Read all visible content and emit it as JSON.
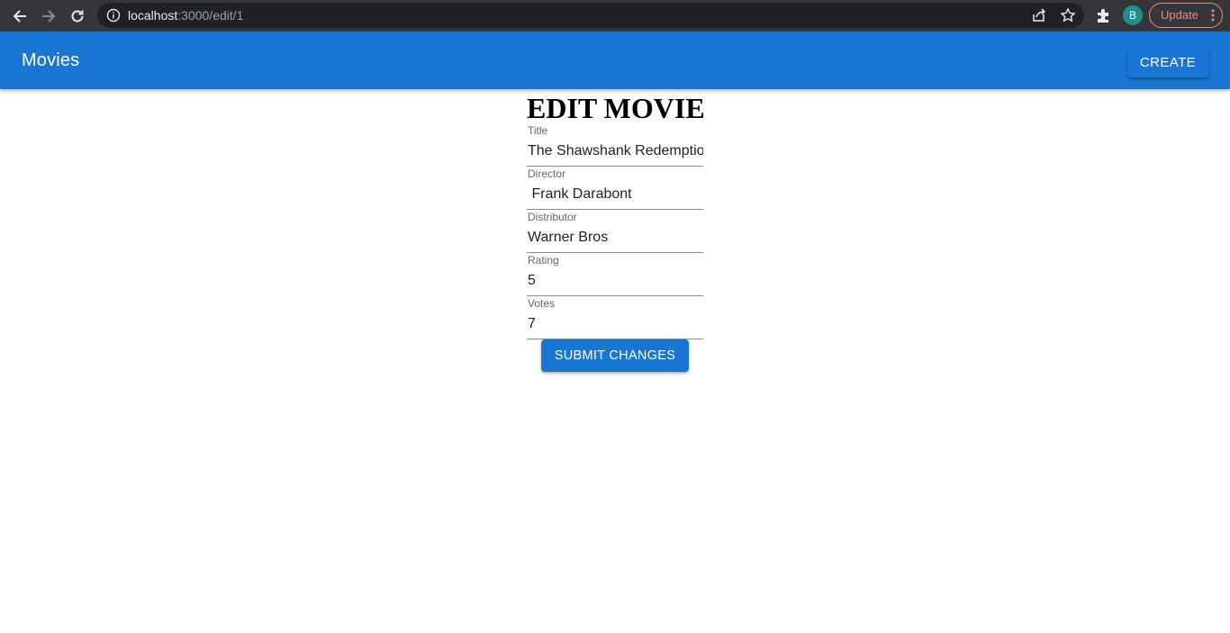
{
  "browser": {
    "url_host": "localhost",
    "url_path": ":3000/edit/1",
    "profile_initial": "B",
    "update_label": "Update"
  },
  "appbar": {
    "title": "Movies",
    "create_label": "CREATE"
  },
  "form": {
    "heading": "EDIT MOVIE",
    "fields": [
      {
        "label": "Title",
        "value": "The Shawshank Redemption"
      },
      {
        "label": "Director",
        "value": " Frank Darabont"
      },
      {
        "label": "Distributor",
        "value": "Warner Bros"
      },
      {
        "label": "Rating",
        "value": "5"
      },
      {
        "label": "Votes",
        "value": "7"
      }
    ],
    "submit_label": "SUBMIT CHANGES"
  },
  "colors": {
    "primary": "#1976d2",
    "chrome_bg": "#35363a",
    "omnibox_bg": "#202124",
    "update_accent": "#f28b82"
  }
}
